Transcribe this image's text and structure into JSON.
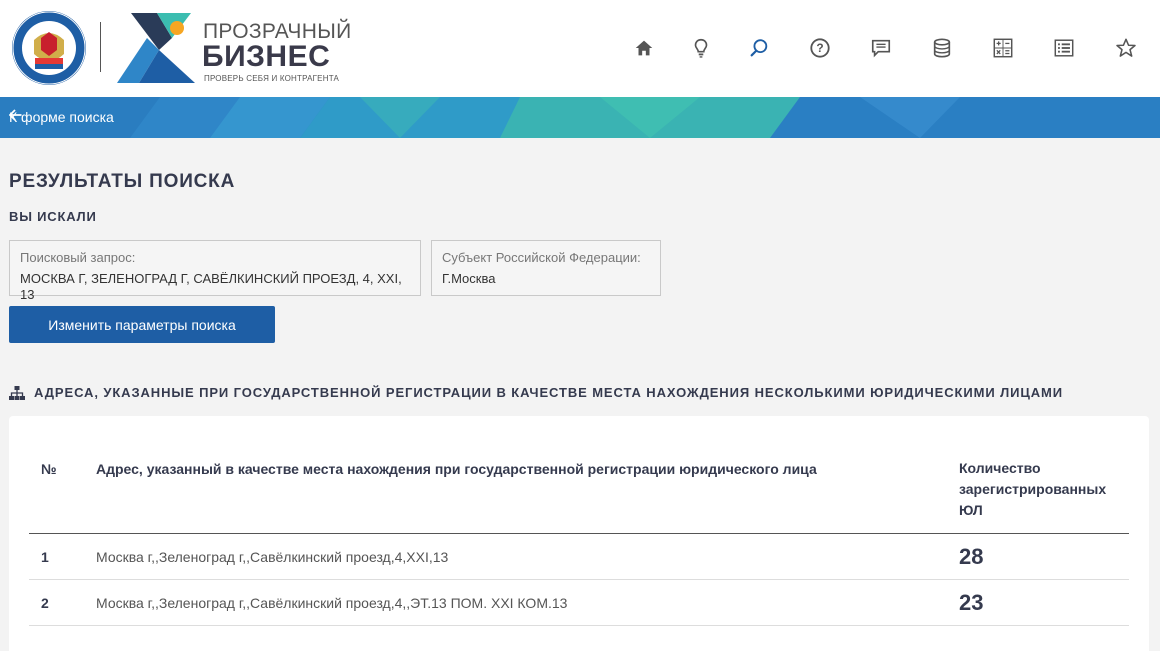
{
  "header": {
    "brand_line1": "ПРОЗРАЧНЫЙ",
    "brand_line2": "БИЗНЕС",
    "brand_tagline": "ПРОВЕРЬ СЕБЯ И КОНТРАГЕНТА",
    "nav_icons": [
      "home-icon",
      "lightbulb-icon",
      "search-icon",
      "help-icon",
      "chat-icon",
      "database-icon",
      "calculator-icon",
      "list-icon",
      "star-icon"
    ]
  },
  "banner": {
    "back_label": "К форме поиска"
  },
  "results": {
    "title": "РЕЗУЛЬТАТЫ ПОИСКА",
    "subtitle": "ВЫ ИСКАЛИ",
    "query_label": "Поисковый запрос:",
    "query_value": "МОСКВА Г, ЗЕЛЕНОГРАД Г, САВЁЛКИНСКИЙ ПРОЕЗД, 4, XXI, 13",
    "region_label": "Субъект Российской Федерации:",
    "region_value": "Г.Москва",
    "change_button": "Изменить параметры поиска"
  },
  "section": {
    "title": "АДРЕСА, УКАЗАННЫЕ ПРИ ГОСУДАРСТВЕННОЙ РЕГИСТРАЦИИ В КАЧЕСТВЕ МЕСТА НАХОЖДЕНИЯ НЕСКОЛЬКИМИ ЮРИДИЧЕСКИМИ ЛИЦАМИ"
  },
  "table": {
    "col_num": "№",
    "col_address": "Адрес, указанный в качестве места нахождения при государственной регистрации юридического лица",
    "col_count_1": "Количество",
    "col_count_2": "зарегистрированных",
    "col_count_3": "ЮЛ",
    "rows": [
      {
        "num": "1",
        "address": "Москва г,,Зеленоград г,,Савёлкинский проезд,4,XXI,13",
        "count": "28"
      },
      {
        "num": "2",
        "address": "Москва г,,Зеленоград г,,Савёлкинский проезд,4,,ЭТ.13 ПОМ. XXI КОМ.13",
        "count": "23"
      }
    ]
  },
  "colors": {
    "primary_button": "#1e5ea5",
    "banner_blue": "#2f86c8",
    "banner_teal": "#3bbdb0",
    "heading": "#353a4e"
  }
}
